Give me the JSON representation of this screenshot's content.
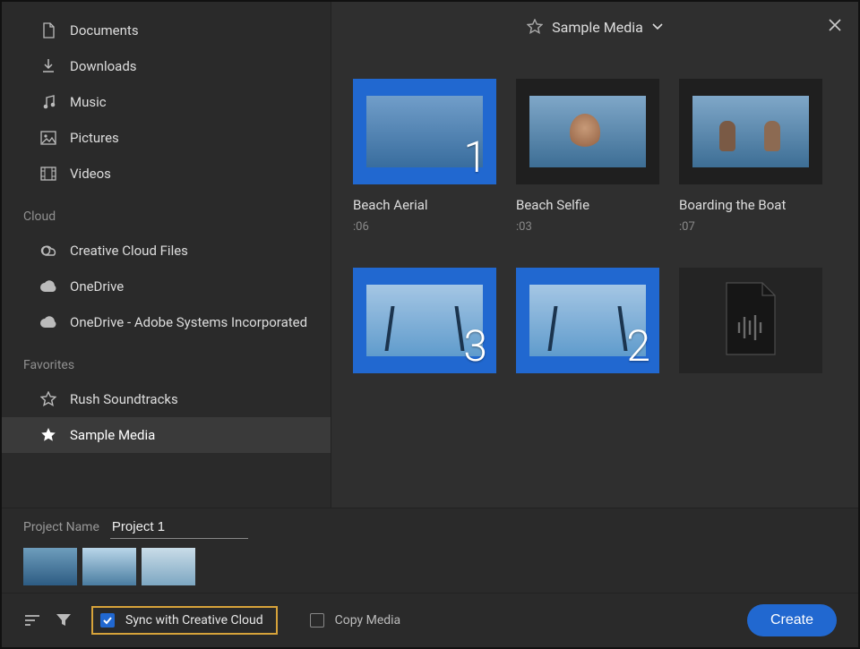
{
  "sidebar": {
    "local": [
      {
        "label": "Documents",
        "icon": "document"
      },
      {
        "label": "Downloads",
        "icon": "download"
      },
      {
        "label": "Music",
        "icon": "music"
      },
      {
        "label": "Pictures",
        "icon": "pictures"
      },
      {
        "label": "Videos",
        "icon": "videos"
      }
    ],
    "cloud_label": "Cloud",
    "cloud": [
      {
        "label": "Creative Cloud Files",
        "icon": "cc"
      },
      {
        "label": "OneDrive",
        "icon": "cloud"
      },
      {
        "label": "OneDrive - Adobe Systems Incorporated",
        "icon": "cloud"
      }
    ],
    "favorites_label": "Favorites",
    "favorites": [
      {
        "label": "Rush Soundtracks",
        "icon": "star-outline",
        "selected": false
      },
      {
        "label": "Sample Media",
        "icon": "star-solid",
        "selected": true
      }
    ]
  },
  "path_title": "Sample Media",
  "media": [
    {
      "name": "Beach Aerial",
      "duration": ":06",
      "selected": true,
      "badge": "1",
      "kind": "video",
      "look": "aerial"
    },
    {
      "name": "Beach Selfie",
      "duration": ":03",
      "selected": false,
      "badge": "",
      "kind": "video",
      "look": "selfie"
    },
    {
      "name": "Boarding the Boat",
      "duration": ":07",
      "selected": false,
      "badge": "",
      "kind": "video",
      "look": "people"
    },
    {
      "name": "",
      "duration": "",
      "selected": true,
      "badge": "3",
      "kind": "video",
      "look": "boat"
    },
    {
      "name": "",
      "duration": "",
      "selected": true,
      "badge": "2",
      "kind": "video",
      "look": "boat"
    },
    {
      "name": "",
      "duration": "",
      "selected": false,
      "badge": "",
      "kind": "audio",
      "look": "audio"
    }
  ],
  "project_name_label": "Project Name",
  "project_name_value": "Project 1",
  "sync_label": "Sync with Creative Cloud",
  "sync_checked": true,
  "copy_label": "Copy Media",
  "copy_checked": false,
  "create_label": "Create"
}
